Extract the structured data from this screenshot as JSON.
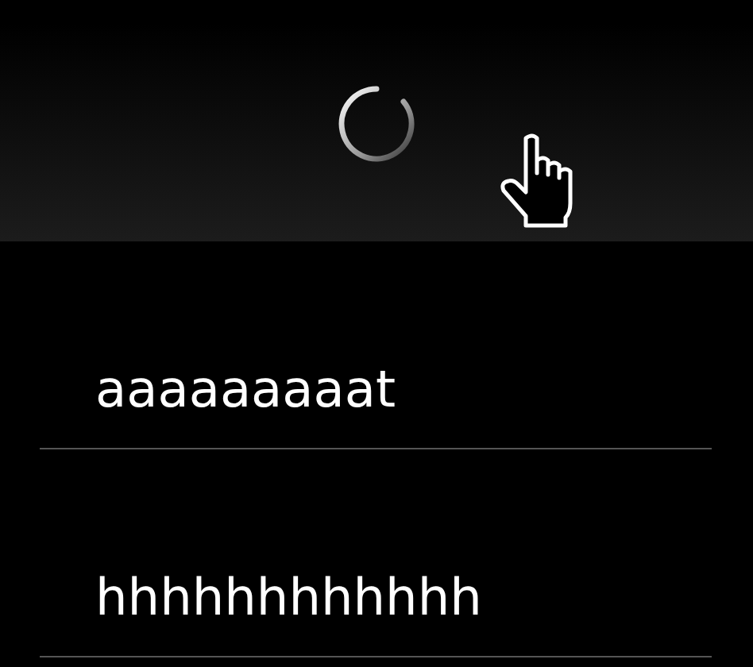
{
  "header": {
    "loading": true,
    "pointer": true
  },
  "items": [
    {
      "label": "aaaaaaaaat"
    },
    {
      "label": "hhhhhhhhhhhh"
    }
  ]
}
